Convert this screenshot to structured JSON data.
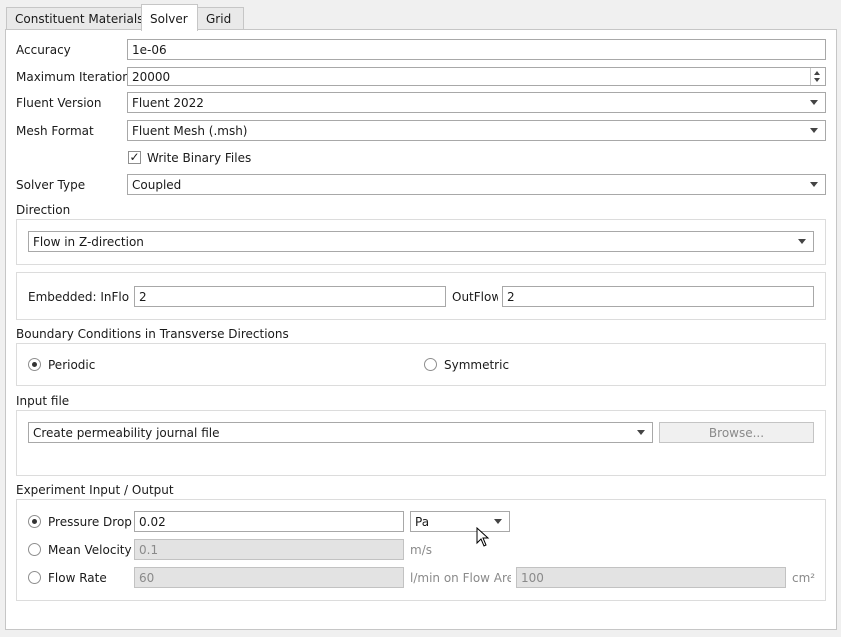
{
  "tabs": [
    {
      "label": "Constituent Materials"
    },
    {
      "label": "Solver"
    },
    {
      "label": "Grid"
    }
  ],
  "solver": {
    "accuracy_label": "Accuracy",
    "accuracy_value": "1e-06",
    "max_iter_label": "Maximum Iterations",
    "max_iter_value": "20000",
    "fluent_version_label": "Fluent Version",
    "fluent_version_value": "Fluent 2022",
    "mesh_format_label": "Mesh Format",
    "mesh_format_value": "Fluent Mesh (.msh)",
    "write_binary_label": "Write Binary Files",
    "write_binary_checked": "✓",
    "solver_type_label": "Solver Type",
    "solver_type_value": "Coupled"
  },
  "direction": {
    "heading": "Direction",
    "value": "Flow in Z-direction"
  },
  "embedded": {
    "inflow_label": "Embedded: InFlow",
    "inflow_value": "2",
    "outflow_label": "OutFlow",
    "outflow_value": "2"
  },
  "boundary": {
    "heading": "Boundary Conditions in Transverse Directions",
    "periodic_label": "Periodic",
    "symmetric_label": "Symmetric",
    "selected": "Periodic"
  },
  "input_file": {
    "heading": "Input file",
    "value": "Create permeability journal file",
    "browse_label": "Browse..."
  },
  "experiment": {
    "heading": "Experiment Input / Output",
    "pressure_drop_label": "Pressure Drop",
    "pressure_drop_value": "0.02",
    "pressure_unit": "Pa",
    "mean_velocity_label": "Mean Velocity",
    "mean_velocity_value": "0.1",
    "mean_velocity_unit": "m/s",
    "flow_rate_label": "Flow Rate",
    "flow_rate_value": "60",
    "flow_rate_unit": "l/min on Flow Area",
    "flow_area_value": "100",
    "flow_area_unit": "cm²",
    "selected": "Pressure Drop"
  },
  "icons": {
    "dropdown": "chevron-down-icon",
    "spinner": "spinner-arrows-icon",
    "cursor": "mouse-pointer-icon"
  }
}
